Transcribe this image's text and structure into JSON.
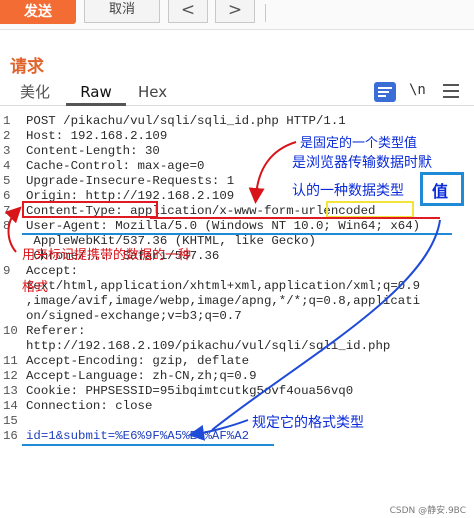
{
  "toolbar": {
    "send_label": "发送",
    "cancel_label": "取消",
    "prev_label": "<",
    "next_label": ">"
  },
  "section": {
    "title": "请求"
  },
  "tabs": {
    "pretty": "美化",
    "raw": "Raw",
    "hex": "Hex",
    "newline": "\\n"
  },
  "editor": {
    "lines": [
      {
        "n": "1",
        "text": "POST /pikachu/vul/sqli/sqli_id.php HTTP/1.1"
      },
      {
        "n": "2",
        "text": "Host: 192.168.2.109"
      },
      {
        "n": "3",
        "text": "Content-Length: 30"
      },
      {
        "n": "4",
        "text": "Cache-Control: max-age=0"
      },
      {
        "n": "5",
        "text": "Upgrade-Insecure-Requests: 1"
      },
      {
        "n": "6",
        "text": "Origin: http://192.168.2.109"
      },
      {
        "n": "7",
        "text": "Content-Type: application/x-www-form-urlencoded"
      },
      {
        "n": "8",
        "text": "User-Agent: Mozilla/5.0 (Windows NT 10.0; Win64; x64)"
      },
      {
        "n": "",
        "text": " AppleWebKit/537.36 (KHTML, like Gecko)"
      },
      {
        "n": "",
        "text": " Chrome/...  Safari/537.36"
      },
      {
        "n": "9",
        "text": "Accept:"
      },
      {
        "n": "",
        "text": "text/html,application/xhtml+xml,application/xml;q=0.9"
      },
      {
        "n": "",
        "text": ",image/avif,image/webp,image/apng,*/*;q=0.8,applicati"
      },
      {
        "n": "",
        "text": "on/signed-exchange;v=b3;q=0.7"
      },
      {
        "n": "10",
        "text": "Referer:"
      },
      {
        "n": "",
        "text": "http://192.168.2.109/pikachu/vul/sqli/sqli_id.php"
      },
      {
        "n": "11",
        "text": "Accept-Encoding: gzip, deflate"
      },
      {
        "n": "12",
        "text": "Accept-Language: zh-CN,zh;q=0.9"
      },
      {
        "n": "13",
        "text": "Cookie: PHPSESSID=95ibqimtcutkg5ovf4oua56vq0"
      },
      {
        "n": "14",
        "text": "Connection: close"
      },
      {
        "n": "15",
        "text": ""
      },
      {
        "n": "16",
        "text": "id=1&submit=%E6%9F%A5%E8%AF%A2"
      }
    ]
  },
  "annotations": {
    "fixed_type": "是固定的一个类型值",
    "browser_default_1": "是浏览器传输数据时默",
    "browser_default_2": "认的一种数据类型",
    "value": "值",
    "format_desc_1": "用来标记提携带的数据的一种",
    "format_desc_2": "格式",
    "specified_format": "规定它的格式类型"
  },
  "watermark": "CSDN @静安.9BC",
  "colors": {
    "send": "#f26c34",
    "accent": "#e0632c",
    "annotation_blue": "#0a2bd9",
    "annotation_red": "#d8141a",
    "box_red": "#e01a22",
    "box_yellow": "#f1e53a",
    "box_blue": "#1f8bd6"
  }
}
